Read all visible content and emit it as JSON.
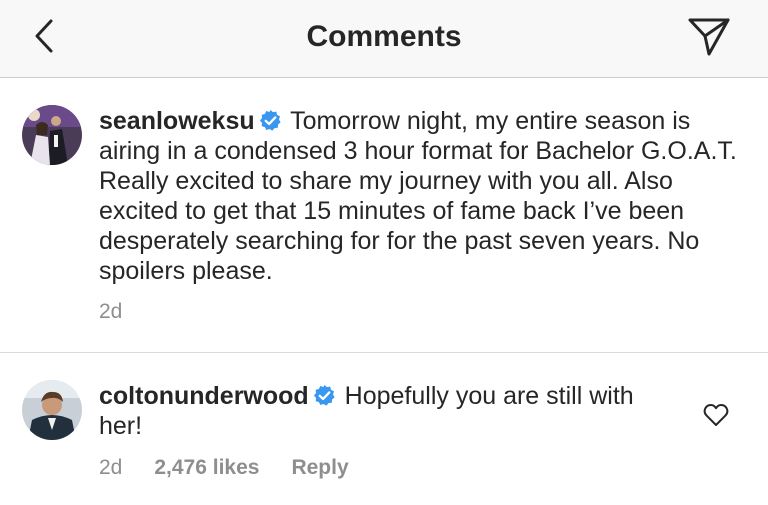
{
  "header": {
    "title": "Comments",
    "back_icon": "chevron-left-icon",
    "send_icon": "paper-plane-icon"
  },
  "caption": {
    "username": "seanloweksu",
    "verified": true,
    "text": "Tomorrow night, my entire season is airing in a condensed 3 hour format for Bachelor G.O.A.T. Really excited to share my journey with you all. Also excited to get that 15 minutes of fame back I’ve been desperately searching for for the past seven years. No spoilers please.",
    "time": "2d"
  },
  "comments": [
    {
      "username": "coltonunderwood",
      "verified": true,
      "text": "Hopefully you are still with her!",
      "time": "2d",
      "likes": "2,476 likes",
      "reply_label": "Reply",
      "like_icon": "heart-outline-icon"
    }
  ],
  "colors": {
    "verified_badge": "#3897f0",
    "text": "#262626",
    "meta": "#8e8e8e",
    "header_bg": "#f8f8f8"
  }
}
